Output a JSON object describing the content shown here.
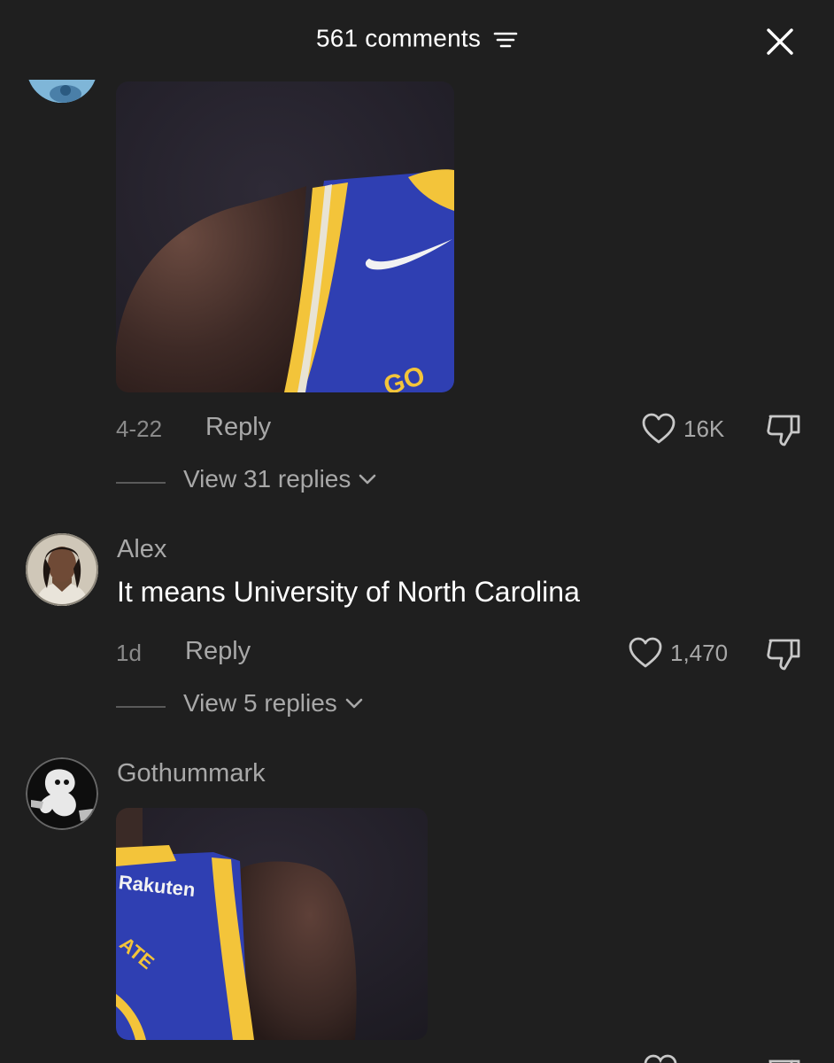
{
  "header": {
    "title": "561 comments",
    "sort_icon": "sort-lines-icon",
    "close_icon": "close-x-icon"
  },
  "comments": [
    {
      "username": "",
      "content_type": "image",
      "image_text": "GO",
      "time": "4-22",
      "reply_label": "Reply",
      "likes": "16K",
      "view_replies": "View 31 replies"
    },
    {
      "username": "Alex",
      "text": "It means University of North Carolina",
      "time": "1d",
      "reply_label": "Reply",
      "likes": "1,470",
      "view_replies": "View 5 replies"
    },
    {
      "username": "Gothummark",
      "content_type": "image",
      "image_text": "Rakuten",
      "image_text2": "ATE"
    }
  ],
  "colors": {
    "background": "#1f1f1f",
    "jersey_blue": "#2f3fb2",
    "jersey_gold": "#f3c43a",
    "muted_text": "#a8a8a8"
  }
}
